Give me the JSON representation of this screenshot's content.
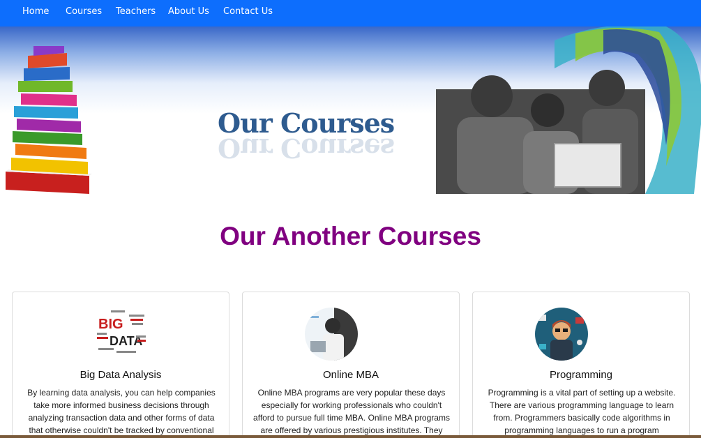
{
  "nav": {
    "items": [
      {
        "label": "Home"
      },
      {
        "label": "Courses"
      },
      {
        "label": "Teachers"
      },
      {
        "label": "About Us"
      },
      {
        "label": "Contact Us"
      }
    ]
  },
  "hero": {
    "title": "Our Courses",
    "reflection": "Our Courses"
  },
  "section": {
    "heading": "Our Another Courses"
  },
  "cards": [
    {
      "title": "Big Data Analysis",
      "image_words": [
        "BIG",
        "DATA"
      ],
      "text": "By learning data analysis, you can help companies take more informed business decisions through analyzing transaction data and other forms of data that otherwise couldn't be tracked by conventional"
    },
    {
      "title": "Online MBA",
      "text": "Online MBA programs are very popular these days especially for working professionals who couldn't afford to pursue full time MBA. Online MBA programs are offered by various prestigious institutes. They"
    },
    {
      "title": "Programming",
      "text": "Programming is a vital part of setting up a website. There are various programming language to learn from. Programmers basically code algorithms in programming languages to run a program"
    }
  ],
  "colors": {
    "nav_bg": "#0d6efd",
    "heading": "#800080",
    "hero_title": "#2e5b8f"
  }
}
